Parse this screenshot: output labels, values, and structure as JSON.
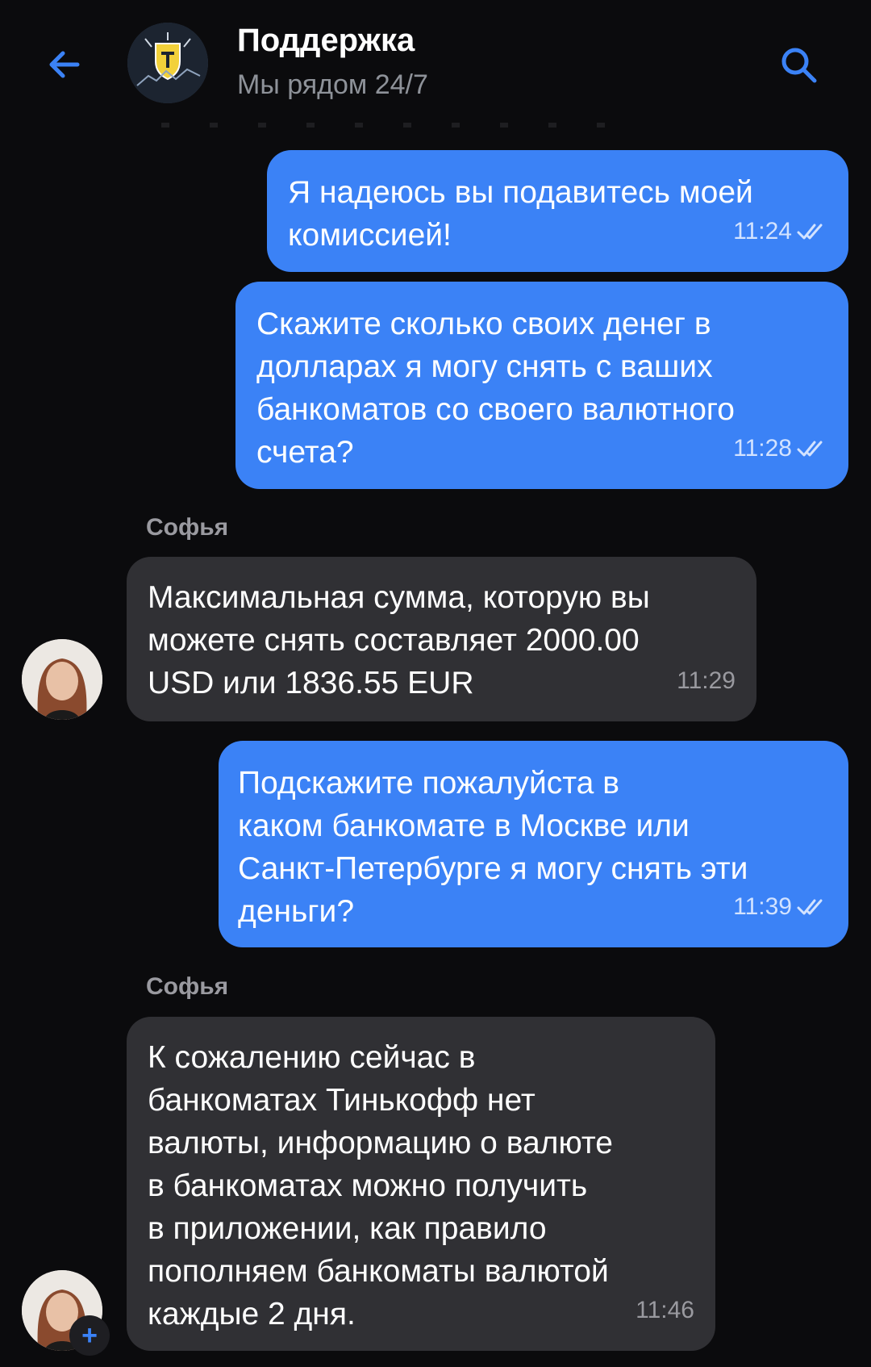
{
  "header": {
    "title": "Поддержка",
    "subtitle": "Мы рядом 24/7"
  },
  "messages": [
    {
      "type": "outgoing",
      "text": "Я надеюсь вы подавитесь моей\nкомиссией!",
      "time": "11:24",
      "status": "read"
    },
    {
      "type": "outgoing",
      "text": "Скажите сколько своих денег в\nдолларах я могу снять с ваших\nбанкоматов со своего валютного\nсчета?",
      "time": "11:28",
      "status": "read"
    },
    {
      "type": "incoming",
      "sender": "Софья",
      "text": "Максимальная сумма, которую вы\nможете снять составляет 2000.00\nUSD или 1836.55 EUR",
      "time": "11:29"
    },
    {
      "type": "outgoing",
      "text": "Подскажите пожалуйста в\nкаком банкомате в Москве или\nСанкт-Петербурге я могу снять эти\nденьги?",
      "time": "11:39",
      "status": "read"
    },
    {
      "type": "incoming",
      "sender": "Софья",
      "text": "К сожалению сейчас в\nбанкоматах Тинькофф нет\nвалюты, информацию о валюте\nв банкоматах можно получить\nв приложении, как правило\nпополняем банкоматы валютой\nкаждые 2 дня.",
      "time": "11:46"
    }
  ],
  "colors": {
    "background": "#0b0b0d",
    "outgoing_bubble": "#3b82f6",
    "incoming_bubble": "#303034",
    "accent": "#3b82f6"
  },
  "icons": {
    "back": "arrow-left-icon",
    "search": "search-icon",
    "read": "double-check-icon",
    "add": "plus-icon"
  }
}
